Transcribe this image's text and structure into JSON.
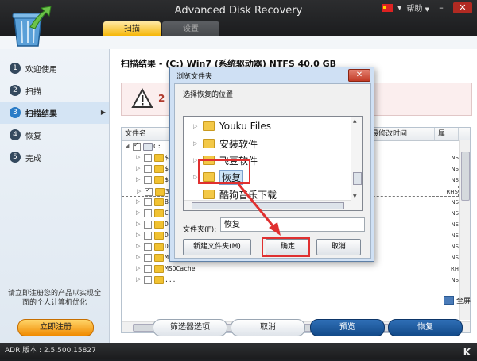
{
  "app": {
    "title": "Advanced Disk Recovery",
    "help_label": "帮助",
    "help_arrow": "▼",
    "tabs": [
      {
        "label": "扫描",
        "active": true
      },
      {
        "label": "设置",
        "active": false
      }
    ]
  },
  "sidebar": {
    "steps": [
      {
        "num": "1",
        "label": "欢迎使用"
      },
      {
        "num": "2",
        "label": "扫描"
      },
      {
        "num": "3",
        "label": "扫描结果",
        "active": true
      },
      {
        "num": "4",
        "label": "恢复"
      },
      {
        "num": "5",
        "label": "完成"
      }
    ],
    "promo_text": "请立即注册您的产品以实现全面的个人计算机优化",
    "register_label": "立即注册"
  },
  "main": {
    "scan_title": "扫描结果 - (C:) Win7 (系统驱动器) NTFS 40.0 GB",
    "warning_text": "2",
    "columns": [
      "文件名",
      "最修改时间",
      "属"
    ],
    "tree_rows": [
      {
        "name": "C:",
        "expanded": true,
        "checked": true,
        "attr": ""
      },
      {
        "name": "$",
        "checked": false,
        "attr": "NS"
      },
      {
        "name": "$",
        "checked": false,
        "attr": "NS"
      },
      {
        "name": "$",
        "checked": false,
        "attr": "NS"
      },
      {
        "name": "3",
        "checked": true,
        "attr": "RHS"
      },
      {
        "name": "B",
        "checked": false,
        "attr": "NS"
      },
      {
        "name": "C",
        "checked": false,
        "attr": "NS"
      },
      {
        "name": "D",
        "checked": false,
        "attr": "NS"
      },
      {
        "name": "D",
        "checked": false,
        "attr": "NS"
      },
      {
        "name": "D",
        "checked": false,
        "attr": "NS"
      },
      {
        "name": "M",
        "checked": false,
        "attr": "NS"
      },
      {
        "name": "MSOCache",
        "checked": false,
        "attr": "RH"
      },
      {
        "name": "...",
        "checked": false,
        "attr": "NS"
      }
    ],
    "fullscreen_label": "全屏",
    "buttons": {
      "filter": "筛选器选项",
      "cancel": "取消",
      "preview": "预览",
      "recover": "恢复"
    }
  },
  "dialog": {
    "title": "浏览文件夹",
    "close": "✕",
    "prompt": "选择恢复的位置",
    "folders": [
      {
        "label": "Youku Files"
      },
      {
        "label": "安装软件"
      },
      {
        "label": "飞豆软件"
      },
      {
        "label": "恢复",
        "selected": true
      },
      {
        "label": "酷狗音乐下载"
      }
    ],
    "folder_field_label": "文件夹(F):",
    "folder_field_value": "恢复",
    "new_folder_button": "新建文件夹(M)",
    "ok_button": "确定",
    "cancel_button": "取消"
  },
  "status": {
    "version": "ADR 版本 : 2.5.500.15827"
  },
  "colors": {
    "accent_blue": "#1b5597",
    "highlight_red": "#e03030",
    "tab_active": "#f5b400"
  }
}
